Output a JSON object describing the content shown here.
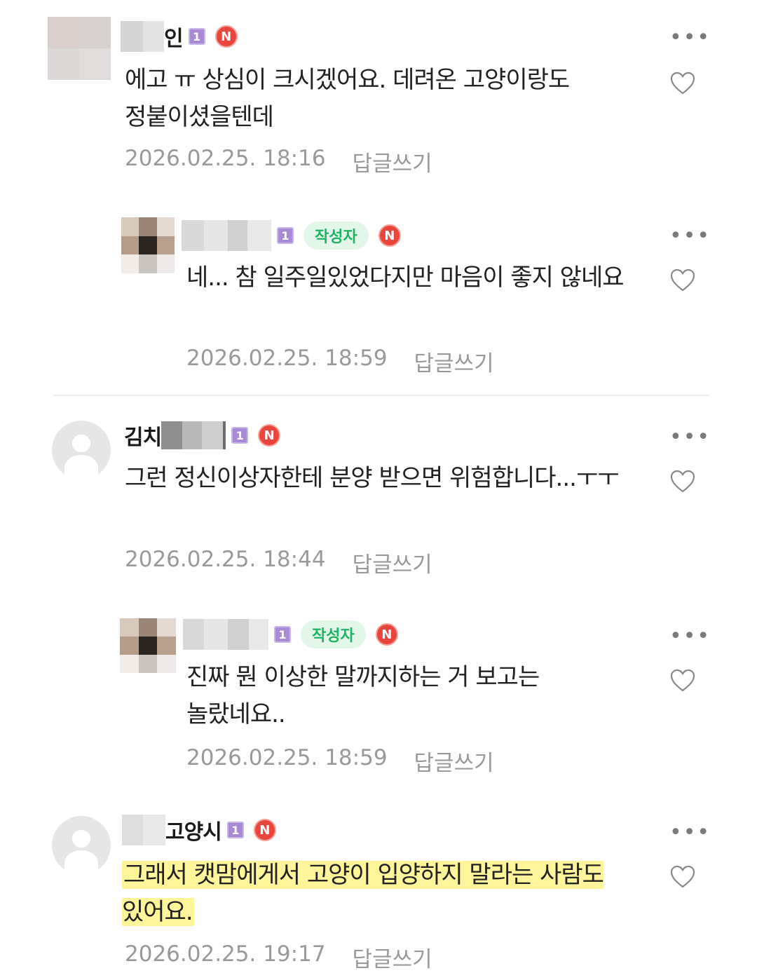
{
  "comments": [
    {
      "name_suffix": "인",
      "level": "1",
      "author_badge": "",
      "new_badge": "N",
      "text": "에고 ㅠ 상심이 크시겠어요. 데려온 고양이랑도 정붙이셨을텐데",
      "date": "2026.02.25. 18:16",
      "reply_label": "답글쓰기"
    },
    {
      "name_suffix": "",
      "level": "1",
      "author_badge": "작성자",
      "new_badge": "N",
      "text": "네... 참 일주일있었다지만 마음이 좋지 않네요",
      "date": "2026.02.25. 18:59",
      "reply_label": "답글쓰기"
    },
    {
      "name_prefix": "김치",
      "level": "1",
      "author_badge": "",
      "new_badge": "N",
      "text": "그런 정신이상자한테 분양 받으면 위험합니다...ㅜㅜ",
      "date": "2026.02.25. 18:44",
      "reply_label": "답글쓰기"
    },
    {
      "name_suffix": "",
      "level": "1",
      "author_badge": "작성자",
      "new_badge": "N",
      "text": "진짜 뭔 이상한 말까지하는 거 보고는 놀랐네요..",
      "date": "2026.02.25. 18:59",
      "reply_label": "답글쓰기"
    },
    {
      "name_suffix": "고양시",
      "level": "1",
      "author_badge": "",
      "new_badge": "N",
      "text": "그래서 캣맘에게서 고양이 입양하지 말라는 사람도 있어요.",
      "date": "2026.02.25. 19:17",
      "reply_label": "답글쓰기"
    }
  ],
  "icons": {
    "more": "more-options-icon",
    "like": "heart-icon"
  },
  "colors": {
    "author_badge_bg": "#e2f7ea",
    "author_badge_text": "#1fb463",
    "new_badge": "#e8463c",
    "level_badge": "#a98ad6",
    "highlight": "#fff59a",
    "meta_text": "#9a9a9a"
  }
}
